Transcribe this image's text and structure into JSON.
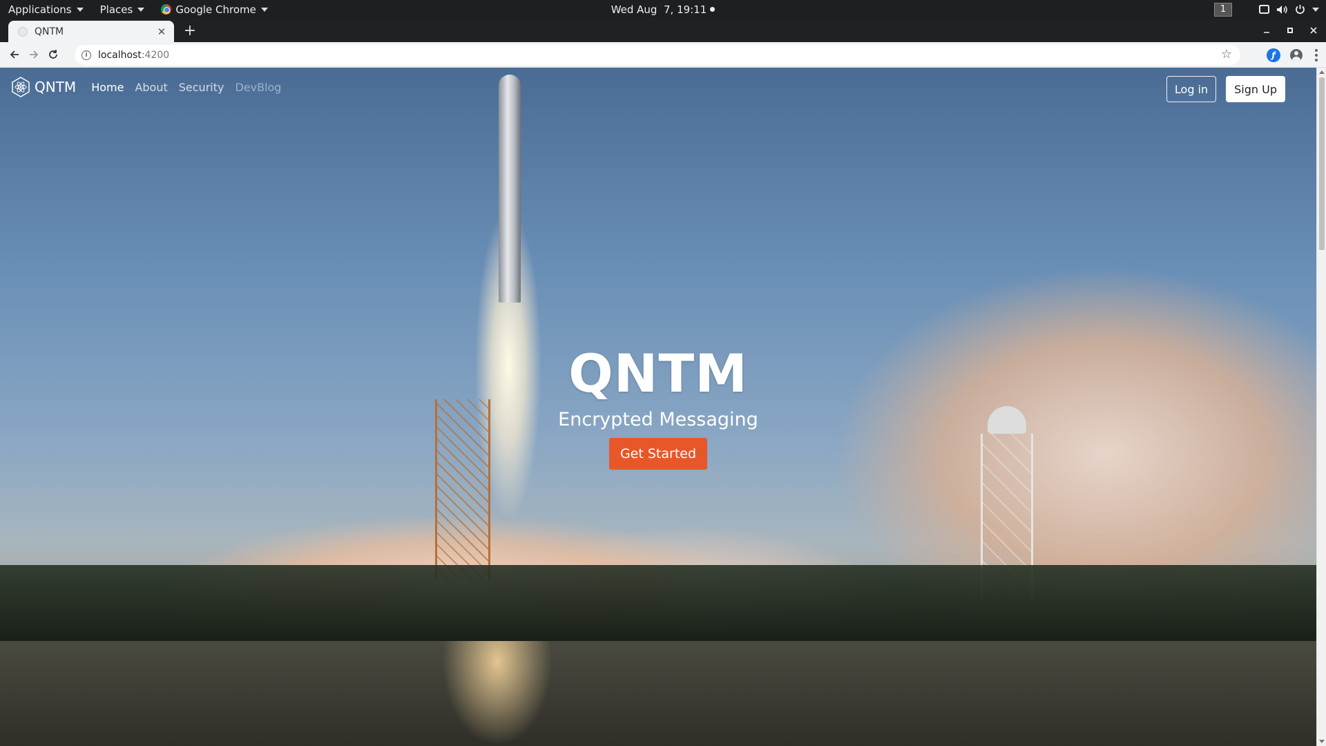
{
  "system_bar": {
    "menus": [
      "Applications",
      "Places",
      "Google Chrome"
    ],
    "clock": "Wed Aug  7, 19:11",
    "workspace": "1"
  },
  "browser": {
    "tab_title": "QNTM",
    "url_host": "localhost",
    "url_port": ":4200"
  },
  "site": {
    "brand": "QNTM",
    "nav": [
      {
        "label": "Home"
      },
      {
        "label": "About"
      },
      {
        "label": "Security"
      },
      {
        "label": "DevBlog"
      }
    ],
    "login_label": "Log in",
    "signup_label": "Sign Up"
  },
  "hero": {
    "title": "QNTM",
    "subtitle": "Encrypted Messaging",
    "cta_label": "Get Started"
  },
  "colors": {
    "cta": "#e8572a",
    "panel": "#1d1f21",
    "tabstrip": "#202124"
  }
}
